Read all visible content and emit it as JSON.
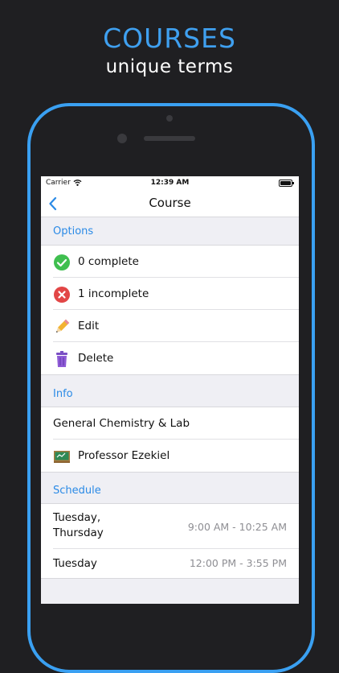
{
  "promo": {
    "headline": "COURSES",
    "subline": "unique terms"
  },
  "status_bar": {
    "carrier": "Carrier",
    "time": "12:39 AM"
  },
  "nav": {
    "title": "Course",
    "back_icon": "chevron-left-icon"
  },
  "colors": {
    "accent": "#3aa0f2",
    "background": "#1f1f22",
    "success": "#3fbf4f",
    "danger": "#e24646",
    "trash": "#8e5bd6"
  },
  "options": {
    "header": "Options",
    "items": [
      {
        "label": "0 complete",
        "icon": "check-circle-icon"
      },
      {
        "label": "1 incomplete",
        "icon": "x-circle-icon"
      },
      {
        "label": "Edit",
        "icon": "pencil-icon"
      },
      {
        "label": "Delete",
        "icon": "trash-icon"
      }
    ]
  },
  "info": {
    "header": "Info",
    "course_name": "General Chemistry & Lab",
    "professor": "Professor Ezekiel",
    "professor_icon": "chalkboard-icon"
  },
  "schedule": {
    "header": "Schedule",
    "rows": [
      {
        "day_line1": "Tuesday,",
        "day_line2": "Thursday",
        "time": "9:00 AM - 10:25 AM"
      },
      {
        "day_line1": "Tuesday",
        "day_line2": "",
        "time": "12:00 PM - 3:55 PM"
      }
    ]
  }
}
